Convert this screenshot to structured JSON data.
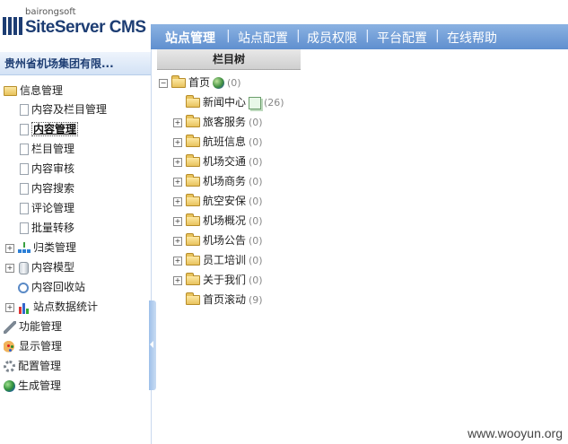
{
  "logo": {
    "small": "bairongsoft",
    "brand": "SiteServer CMS"
  },
  "nav": {
    "items": [
      "站点管理",
      "站点配置",
      "成员权限",
      "平台配置",
      "在线帮助"
    ],
    "separator": "|"
  },
  "sidebar": {
    "site_title": "贵州省机场集团有限...",
    "items": [
      {
        "label": "信息管理",
        "icon": "folder-open-icon"
      },
      {
        "label": "内容及栏目管理",
        "icon": "document-icon"
      },
      {
        "label": "内容管理",
        "icon": "document-icon",
        "active": true
      },
      {
        "label": "栏目管理",
        "icon": "document-icon"
      },
      {
        "label": "内容审核",
        "icon": "document-icon"
      },
      {
        "label": "内容搜索",
        "icon": "document-icon"
      },
      {
        "label": "评论管理",
        "icon": "document-icon"
      },
      {
        "label": "批量转移",
        "icon": "document-icon"
      },
      {
        "label": "归类管理",
        "icon": "tree-structure-icon"
      },
      {
        "label": "内容模型",
        "icon": "database-icon"
      },
      {
        "label": "内容回收站",
        "icon": "recycle-bin-icon"
      },
      {
        "label": "站点数据统计",
        "icon": "bar-chart-icon"
      },
      {
        "label": "功能管理",
        "icon": "wrench-icon"
      },
      {
        "label": "显示管理",
        "icon": "palette-icon"
      },
      {
        "label": "配置管理",
        "icon": "gear-icon"
      },
      {
        "label": "生成管理",
        "icon": "globe-icon"
      }
    ]
  },
  "tree": {
    "header": "栏目树",
    "root": {
      "label": "首页",
      "count": "(0)"
    },
    "nodes": [
      {
        "label": "新闻中心",
        "count": "(26)"
      },
      {
        "label": "旅客服务",
        "count": "(0)"
      },
      {
        "label": "航班信息",
        "count": "(0)"
      },
      {
        "label": "机场交通",
        "count": "(0)"
      },
      {
        "label": "机场商务",
        "count": "(0)"
      },
      {
        "label": "航空安保",
        "count": "(0)"
      },
      {
        "label": "机场概况",
        "count": "(0)"
      },
      {
        "label": "机场公告",
        "count": "(0)"
      },
      {
        "label": "员工培训",
        "count": "(0)"
      },
      {
        "label": "关于我们",
        "count": "(0)"
      },
      {
        "label": "首页滚动",
        "count": "(9)"
      }
    ]
  },
  "watermark": "www.wooyun.org",
  "colors": {
    "nav_bg": "#6d99d4",
    "brand": "#1d3d73",
    "panel_border": "#c9d9ef"
  }
}
